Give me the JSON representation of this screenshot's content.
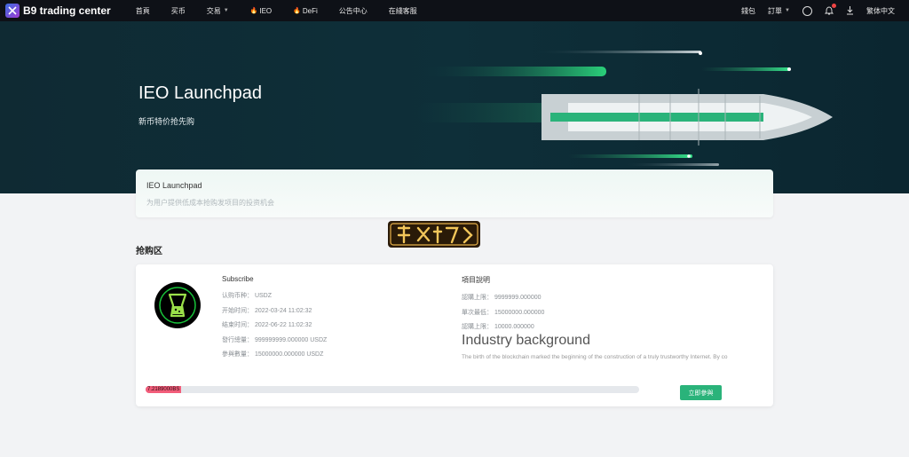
{
  "brand": {
    "name": "B9 trading center"
  },
  "nav": {
    "items": [
      {
        "label": "首頁",
        "fire": false,
        "caret": false
      },
      {
        "label": "买币",
        "fire": false,
        "caret": false
      },
      {
        "label": "交易",
        "fire": false,
        "caret": true
      },
      {
        "label": "IEO",
        "fire": true,
        "caret": false
      },
      {
        "label": "DeFi",
        "fire": true,
        "caret": false
      },
      {
        "label": "公告中心",
        "fire": false,
        "caret": false
      },
      {
        "label": "在綫客服",
        "fire": false,
        "caret": false
      }
    ],
    "right": {
      "wallet": "錢包",
      "orders": "訂單",
      "language": "繁体中文"
    }
  },
  "hero": {
    "title": "IEO Launchpad",
    "subtitle": "新币特价抢先购"
  },
  "info_card": {
    "title": "IEO Launchpad",
    "desc": "为用户提供低成本抢购发项目的投资机会"
  },
  "section": {
    "title": "抢购区"
  },
  "subscribe": {
    "heading": "Subscribe",
    "rows": [
      "认购币种： USDZ",
      "开始时间： 2022-03-24 11:02:32",
      "结束时间： 2022-06-22 11:02:32",
      "發行總量： 999999999.000000 USDZ",
      "參與數量： 15000000.000000 USDZ"
    ]
  },
  "project": {
    "heading": "項目說明",
    "rows": [
      "認購上限： 9999999.000000",
      "單次最低： 15000000.000000",
      "認購上限： 10000.000000"
    ],
    "industry_title": "Industry background",
    "industry_text": "The birth of the blockchain marked the beginning of the construction of a truly trustworthy Internet. By co"
  },
  "progress": {
    "label": "7.2189000BS",
    "percent": 7.2
  },
  "button": {
    "label": "立即參與"
  },
  "colors": {
    "accent": "#2ab37a",
    "progress": "#f25d7a",
    "hero_bg": "#0e2f39"
  }
}
